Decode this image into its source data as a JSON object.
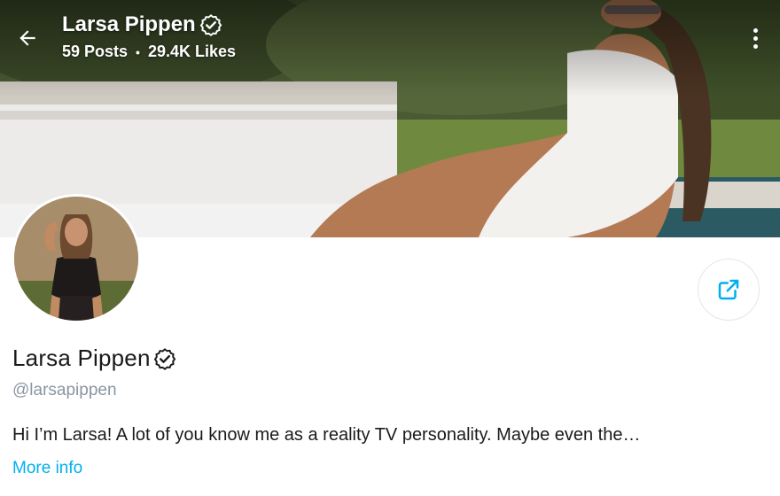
{
  "header": {
    "title": "Larsa Pippen",
    "posts": "59 Posts",
    "separator": "•",
    "likes": "29.4K Likes"
  },
  "icons": {
    "back": "arrow-left-icon",
    "verified": "verified-badge-icon",
    "more": "vertical-dots-icon",
    "share": "share-icon"
  },
  "profile": {
    "name": "Larsa Pippen",
    "handle": "@larsapippen",
    "bio": "Hi I’m Larsa! A lot of you know me as a reality TV personality. Maybe even the…",
    "more_info": "More info"
  },
  "colors": {
    "accent": "#00aff0",
    "handle": "#8a96a3",
    "text": "#1a1a1a"
  }
}
